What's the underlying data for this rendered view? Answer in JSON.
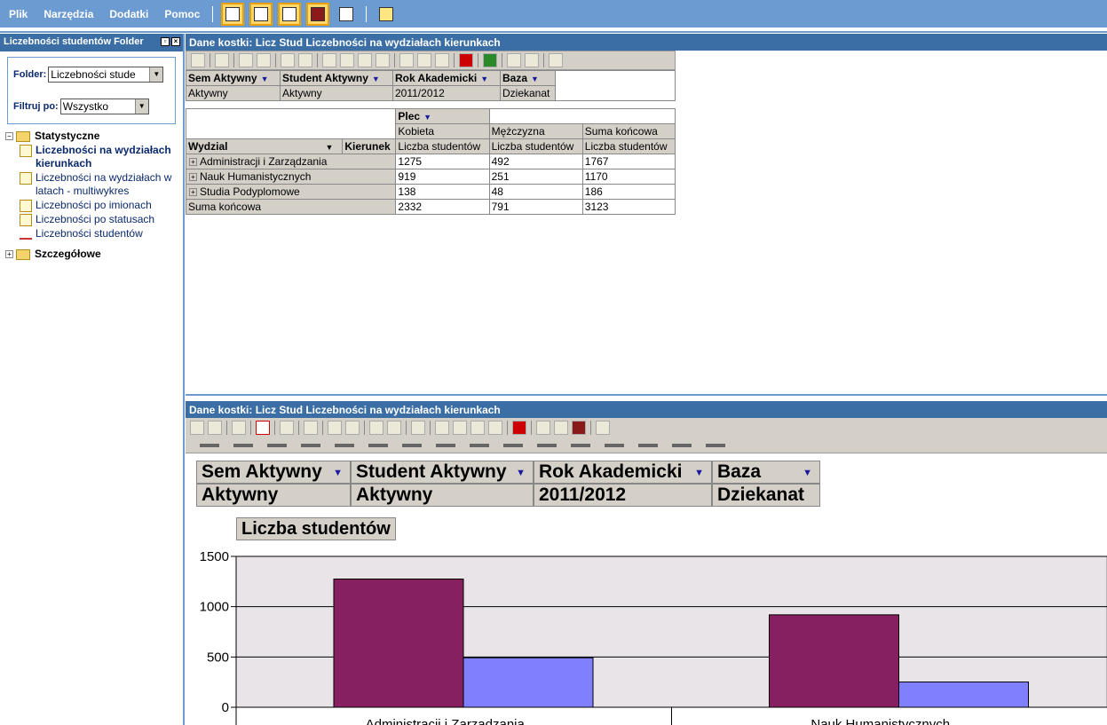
{
  "menu": {
    "items": [
      "Plik",
      "Narzędzia",
      "Dodatki",
      "Pomoc"
    ],
    "toolbar_icons": [
      "list-view-icon",
      "window-icon",
      "table-edit-icon",
      "book-icon",
      "print-icon",
      "export-icon"
    ]
  },
  "left_panel": {
    "title": "Liczebności studentów Folder",
    "folder_label": "Folder:",
    "folder_value": "Liczebności stude",
    "filter_label": "Filtruj po:",
    "filter_value": "Wszystko",
    "tree": {
      "statystyczne": {
        "label": "Statystyczne",
        "expander": "−",
        "children": [
          {
            "line1": "Liczebności na wydziałach",
            "line2": "kierunkach",
            "active": true
          },
          {
            "line1": "Liczebności na wydziałach w",
            "line2": "latach - multiwykres",
            "active": false
          },
          {
            "line1": "Liczebności po imionach",
            "line2": "",
            "active": false
          },
          {
            "line1": "Liczebności po statusach",
            "line2": "",
            "active": false
          },
          {
            "line1": "Liczebności studentów",
            "line2": "",
            "active": false
          }
        ]
      },
      "szczegolowe": {
        "label": "Szczegółowe",
        "expander": "+"
      }
    }
  },
  "top_region": {
    "title": "Dane kostki: Licz Stud Liczebności na wydziałach kierunkach",
    "filters": [
      {
        "name": "Sem Aktywny",
        "value": "Aktywny"
      },
      {
        "name": "Student Aktywny",
        "value": "Aktywny"
      },
      {
        "name": "Rok Akademicki",
        "value": "2011/2012"
      },
      {
        "name": "Baza",
        "value": "Dziekanat"
      }
    ],
    "column_field": "Plec",
    "column_values": [
      "Kobieta",
      "Mężczyzna",
      "Suma końcowa"
    ],
    "measure": "Liczba studentów",
    "row_field": "Wydzial",
    "row_field2": "Kierunek",
    "rows": [
      {
        "label": "Administracji i Zarządzania",
        "values": [
          "1275",
          "492",
          "1767"
        ]
      },
      {
        "label": "Nauk Humanistycznych",
        "values": [
          "919",
          "251",
          "1170"
        ]
      },
      {
        "label": "Studia Podyplomowe",
        "values": [
          "138",
          "48",
          "186"
        ]
      }
    ],
    "total": {
      "label": "Suma końcowa",
      "values": [
        "2332",
        "791",
        "3123"
      ]
    }
  },
  "bottom_region": {
    "title": "Dane kostki: Licz Stud Liczebności na wydziałach kierunkach",
    "filters": [
      {
        "name": "Sem Aktywny",
        "value": "Aktywny"
      },
      {
        "name": "Student Aktywny",
        "value": "Aktywny"
      },
      {
        "name": "Rok Akademicki",
        "value": "2011/2012"
      },
      {
        "name": "Baza",
        "value": "Dziekanat"
      }
    ],
    "series_label": "Liczba studentów"
  },
  "chart_data": {
    "type": "bar",
    "categories": [
      "Administracji i Zarządzania",
      "Nauk Humanistycznych"
    ],
    "series": [
      {
        "name": "Kobieta",
        "values": [
          1275,
          919
        ],
        "color": "#862060"
      },
      {
        "name": "Mężczyzna",
        "values": [
          492,
          251
        ],
        "color": "#8080ff"
      }
    ],
    "ylim": [
      0,
      1500
    ],
    "yticks": [
      "0",
      "500",
      "1000",
      "1500"
    ],
    "title": "",
    "xlabel": "",
    "ylabel": "",
    "grid": true,
    "colors": {
      "plot_bg": "#e8e4e8",
      "header_blue": "#3a6ea5",
      "menubar": "#6b9bd1"
    }
  }
}
